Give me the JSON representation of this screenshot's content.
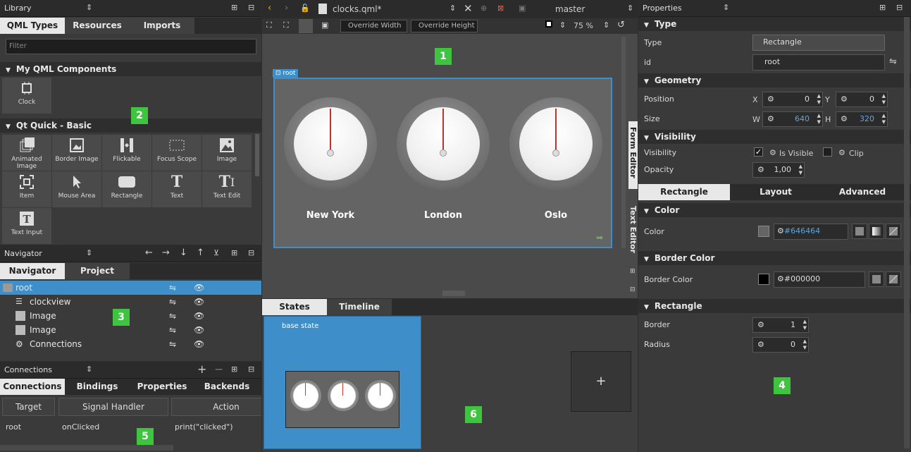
{
  "library": {
    "title": "Library",
    "tabs": [
      "QML Types",
      "Resources",
      "Imports"
    ],
    "filter_placeholder": "Filter",
    "sections": {
      "my_components": "My QML Components",
      "qt_quick_basic": "Qt Quick - Basic"
    },
    "my_components_items": [
      "Clock"
    ],
    "basic_items": [
      "Animated Image",
      "Border Image",
      "Flickable",
      "Focus Scope",
      "Image",
      "Item",
      "Mouse Area",
      "Rectangle",
      "Text",
      "Text Edit",
      "Text Input"
    ]
  },
  "navigator": {
    "title": "Navigator",
    "tabs": [
      "Navigator",
      "Project"
    ],
    "items": [
      "root",
      "clockview",
      "Image",
      "Image",
      "Connections"
    ]
  },
  "connections": {
    "title": "Connections",
    "tabs": [
      "Connections",
      "Bindings",
      "Properties",
      "Backends"
    ],
    "columns": [
      "Target",
      "Signal Handler",
      "Action"
    ],
    "rows": [
      {
        "target": "root",
        "signal": "onClicked",
        "action": "print(\"clicked\")"
      }
    ]
  },
  "editor": {
    "file": "clocks.qml*",
    "branch": "master",
    "override_width": "Override Width",
    "override_height": "Override Height",
    "zoom": "75 %",
    "root_label": "root",
    "cities": [
      "New York",
      "London",
      "Oslo"
    ],
    "side_tabs": [
      "Form Editor",
      "Text Editor"
    ]
  },
  "states": {
    "tabs": [
      "States",
      "Timeline"
    ],
    "base_state": "base state",
    "add": "+"
  },
  "properties": {
    "title": "Properties",
    "type_section": "Type",
    "type_label": "Type",
    "type_value": "Rectangle",
    "id_label": "id",
    "id_value": "root",
    "geometry_section": "Geometry",
    "position_label": "Position",
    "x_label": "X",
    "x_value": "0",
    "y_label": "Y",
    "y_value": "0",
    "size_label": "Size",
    "w_label": "W",
    "w_value": "640",
    "h_label": "H",
    "h_value": "320",
    "visibility_section": "Visibility",
    "visibility_label": "Visibility",
    "is_visible": "Is Visible",
    "clip": "Clip",
    "opacity_label": "Opacity",
    "opacity_value": "1,00",
    "subtabs": [
      "Rectangle",
      "Layout",
      "Advanced"
    ],
    "color_section": "Color",
    "color_label": "Color",
    "color_value": "#646464",
    "border_color_section": "Border Color",
    "border_color_label": "Border Color",
    "border_color_value": "#000000",
    "rectangle_section": "Rectangle",
    "border_label": "Border",
    "border_value": "1",
    "radius_label": "Radius",
    "radius_value": "0"
  },
  "badges": [
    "1",
    "2",
    "3",
    "4",
    "5",
    "6"
  ],
  "colors": {
    "selection": "#3d8ec9",
    "badge": "#3ec43e",
    "canvas": "#646464",
    "border_color": "#000000"
  }
}
